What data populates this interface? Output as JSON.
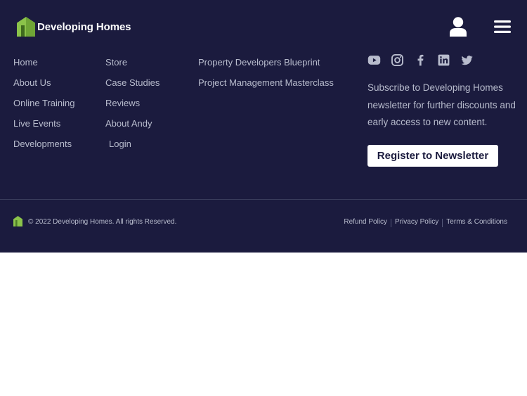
{
  "header": {
    "logo_text": "Developing Homes",
    "icons": [
      "user-icon",
      "hamburger-menu-icon"
    ]
  },
  "footer": {
    "columns": [
      {
        "links": [
          "Home",
          "About Us",
          "Online Training",
          "Live Events",
          "Developments"
        ]
      },
      {
        "links": [
          "Store",
          "Case Studies",
          "Reviews",
          "About Andy",
          "Login"
        ]
      },
      {
        "links": [
          "Property Developers Blueprint",
          "Project Management Masterclass"
        ]
      }
    ],
    "socials": [
      "youtube-icon",
      "instagram-icon",
      "facebook-icon",
      "linkedin-icon",
      "twitter-icon"
    ],
    "newsletter_text": "Subscribe to Developing Homes newsletter for further discounts and early access to new content.",
    "register_label": "Register to Newsletter",
    "copyright": "© 2022 Developing Homes. All rights Reserved.",
    "legal_links": [
      "Refund Policy",
      "Privacy Policy",
      "Terms & Conditions"
    ]
  },
  "colors": {
    "background": "#1b1b3e",
    "accent_green": "#8bc34a",
    "link_text": "#b8bccd",
    "button_bg": "#ffffff"
  }
}
